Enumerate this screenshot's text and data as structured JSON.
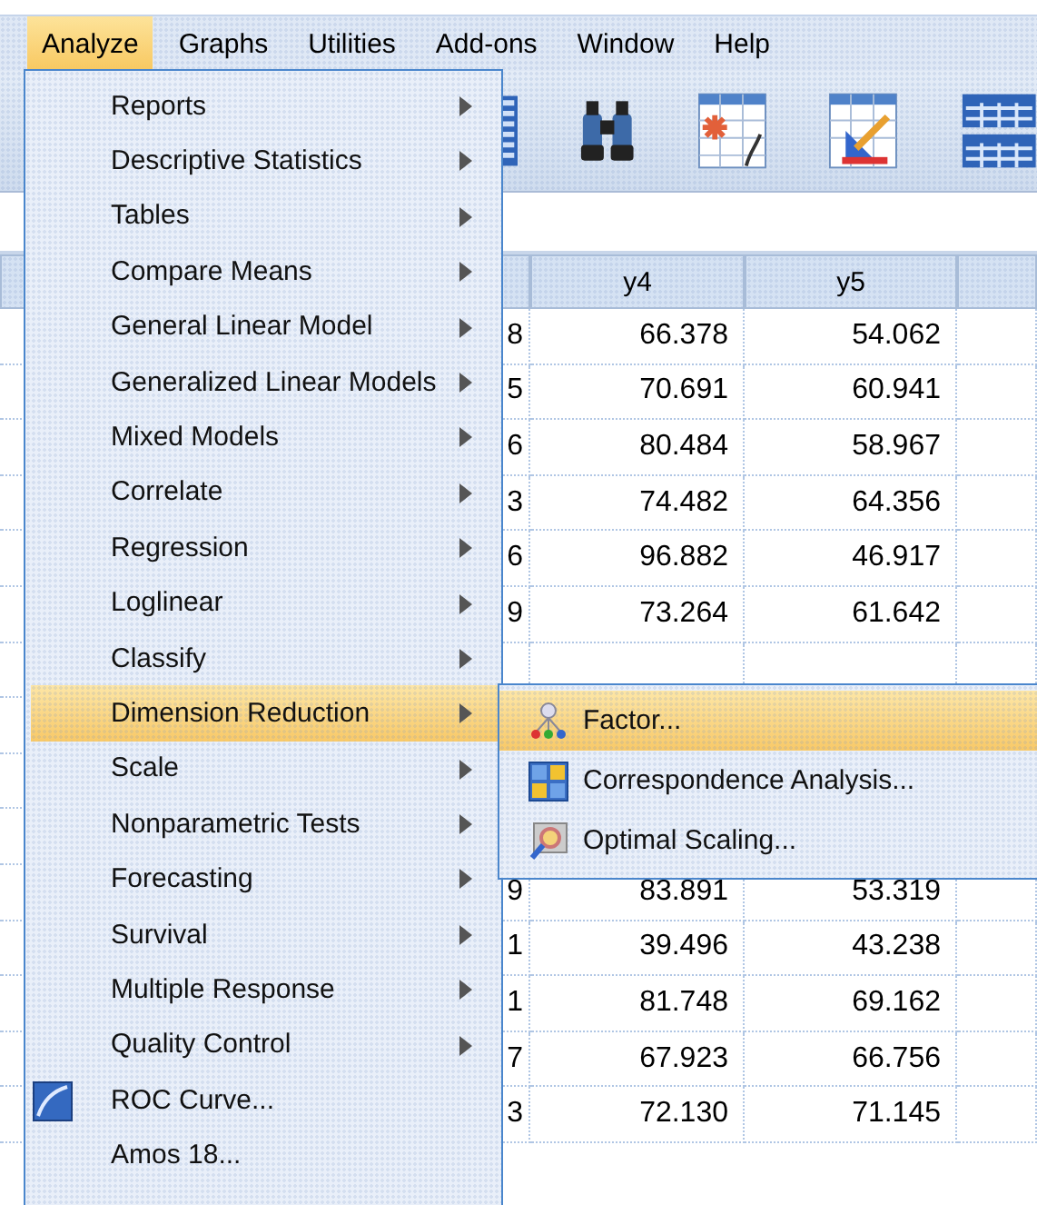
{
  "menu_bar": [
    {
      "label": "Analyze",
      "selected": true
    },
    {
      "label": "Graphs",
      "selected": false
    },
    {
      "label": "Utilities",
      "selected": false
    },
    {
      "label": "Add-ons",
      "selected": false
    },
    {
      "label": "Window",
      "selected": false
    },
    {
      "label": "Help",
      "selected": false
    }
  ],
  "analyze_menu": [
    {
      "label": "Reports",
      "kind": "submenu",
      "selected": false
    },
    {
      "label": "Descriptive Statistics",
      "kind": "submenu",
      "selected": false
    },
    {
      "label": "Tables",
      "kind": "submenu",
      "selected": false
    },
    {
      "label": "Compare Means",
      "kind": "submenu",
      "selected": false
    },
    {
      "label": "General Linear Model",
      "kind": "submenu",
      "selected": false
    },
    {
      "label": "Generalized Linear Models",
      "kind": "submenu",
      "selected": false
    },
    {
      "label": "Mixed Models",
      "kind": "submenu",
      "selected": false
    },
    {
      "label": "Correlate",
      "kind": "submenu",
      "selected": false
    },
    {
      "label": "Regression",
      "kind": "submenu",
      "selected": false
    },
    {
      "label": "Loglinear",
      "kind": "submenu",
      "selected": false
    },
    {
      "label": "Classify",
      "kind": "submenu",
      "selected": false
    },
    {
      "label": "Dimension Reduction",
      "kind": "submenu",
      "selected": true
    },
    {
      "label": "Scale",
      "kind": "submenu",
      "selected": false
    },
    {
      "label": "Nonparametric Tests",
      "kind": "submenu",
      "selected": false
    },
    {
      "label": "Forecasting",
      "kind": "submenu",
      "selected": false
    },
    {
      "label": "Survival",
      "kind": "submenu",
      "selected": false
    },
    {
      "label": "Multiple Response",
      "kind": "submenu",
      "selected": false
    },
    {
      "label": "Quality Control",
      "kind": "submenu",
      "selected": false
    },
    {
      "label": "ROC Curve...",
      "kind": "icon-command",
      "selected": false
    },
    {
      "label": "Amos 18...",
      "kind": "command",
      "selected": false
    }
  ],
  "dimension_reduction_submenu": [
    {
      "label": "Factor...",
      "selected": true
    },
    {
      "label": "Correspondence Analysis...",
      "selected": false
    },
    {
      "label": "Optimal Scaling...",
      "selected": false
    }
  ],
  "table": {
    "columns": [
      "y4",
      "y5"
    ],
    "rows_above_submenu": [
      [
        "8",
        "66.378",
        "54.062"
      ],
      [
        "5",
        "70.691",
        "60.941"
      ],
      [
        "6",
        "80.484",
        "58.967"
      ],
      [
        "3",
        "74.482",
        "64.356"
      ],
      [
        "6",
        "96.882",
        "46.917"
      ],
      [
        "9",
        "73.264",
        "61.642"
      ]
    ],
    "rows_below_submenu": [
      [
        "9",
        "83.891",
        "53.319"
      ],
      [
        "1",
        "39.496",
        "43.238"
      ],
      [
        "1",
        "81.748",
        "69.162"
      ],
      [
        "7",
        "67.923",
        "66.756"
      ],
      [
        "3",
        "72.130",
        "71.145"
      ]
    ]
  }
}
